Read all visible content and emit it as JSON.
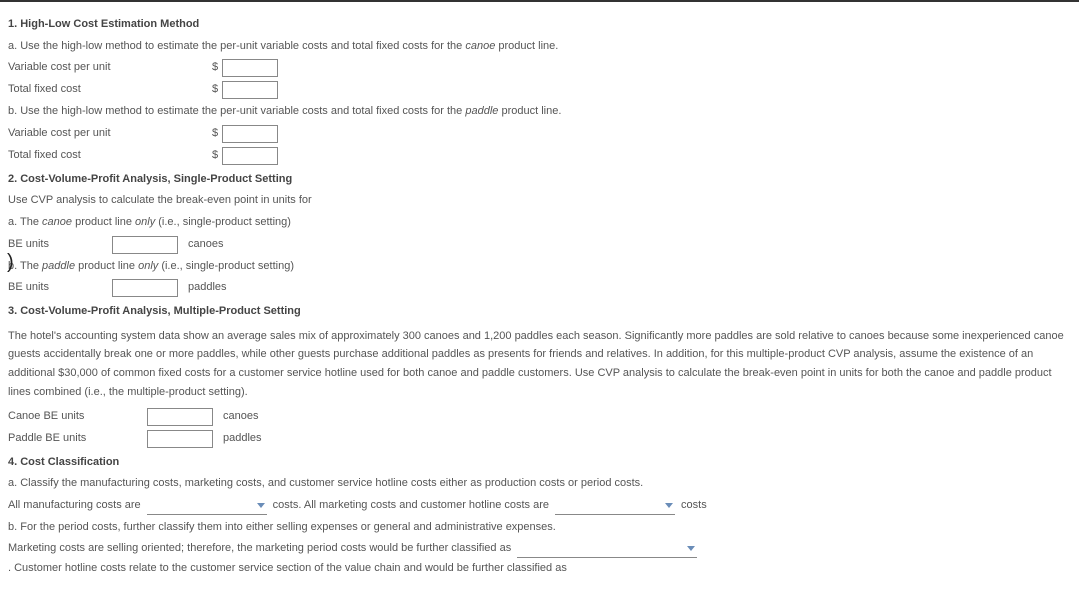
{
  "q1": {
    "heading": "1.  High-Low Cost Estimation Method",
    "a_text_pre": "a. Use the high-low method to estimate the per-unit variable costs and total fixed costs for the ",
    "a_text_em": "canoe",
    "a_text_post": " product line.",
    "var_cost_label": "Variable cost per unit",
    "fixed_cost_label": "Total fixed cost",
    "b_text_pre": "b. Use the high-low method to estimate the per-unit variable costs and total fixed costs for the ",
    "b_text_em": "paddle",
    "b_text_post": " product line.",
    "dollar": "$"
  },
  "q2": {
    "heading": "2.  Cost-Volume-Profit Analysis, Single-Product Setting",
    "sub": "Use CVP analysis to calculate the break-even point in units for",
    "a_pre": "a. The ",
    "a_em": "canoe",
    "a_post_pre": " product line ",
    "a_post_em": "only",
    "a_post_post": " (i.e., single-product setting)",
    "be_label": "BE units",
    "canoes_unit": "canoes",
    "b_pre": "b. The ",
    "b_em": "paddle",
    "b_post_pre": " product line ",
    "b_post_em": "only",
    "b_post_post": " (i.e., single-product setting)",
    "paddles_unit": "paddles"
  },
  "q3": {
    "heading": "3.   Cost-Volume-Profit Analysis, Multiple-Product Setting",
    "para": "The hotel's accounting system data show an average sales mix of approximately 300 canoes and 1,200 paddles each season. Significantly more paddles are sold relative to canoes because some inexperienced canoe guests accidentally break one or more paddles, while other guests purchase additional paddles as presents for friends and relatives. In addition, for this multiple-product CVP analysis, assume the existence of an additional $30,000 of common fixed costs for a customer service hotline used for both canoe and paddle customers. Use CVP analysis to calculate the break-even point in units for both the canoe and paddle product lines combined (i.e., the multiple-product setting).",
    "canoe_be_label": "Canoe BE units",
    "paddle_be_label": "Paddle BE units",
    "canoes_unit": "canoes",
    "paddles_unit": "paddles"
  },
  "q4": {
    "heading": "4.  Cost Classification",
    "a_text": "a. Classify the manufacturing costs, marketing costs, and customer service hotline costs either as production costs or period costs.",
    "a_row_1": "All manufacturing costs are",
    "a_row_2": "costs. All marketing costs and customer hotline costs are",
    "a_row_3": "costs",
    "b_text": "b. For the period costs, further classify them into either selling expenses or general and administrative expenses.",
    "b_row_1": "Marketing costs are selling oriented; therefore, the marketing period costs would be further classified as",
    "b_row_2": ". Customer hotline costs relate to the customer service section of the value chain and would be further classified as"
  }
}
